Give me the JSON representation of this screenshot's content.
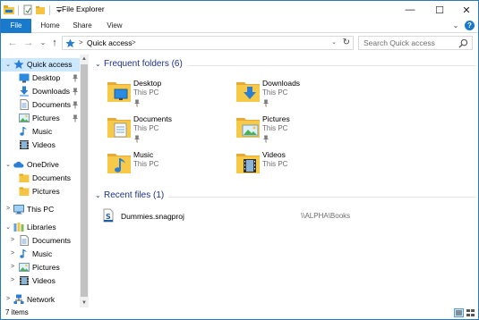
{
  "titlebar": {
    "title": "File Explorer",
    "minimize": "—",
    "maximize": "☐",
    "close": "✕"
  },
  "ribbon": {
    "tabs": [
      "File",
      "Home",
      "Share",
      "View"
    ],
    "expand": "⌄",
    "help": "?"
  },
  "navbar": {
    "back": "←",
    "forward": "→",
    "recent": "⌄",
    "up": "↑",
    "address_sep": ">",
    "location": "Quick access",
    "address_dropdown": "⌄",
    "refresh": "↻"
  },
  "search": {
    "placeholder": "Search Quick access"
  },
  "nav_pane": {
    "items": [
      {
        "label": "Quick access",
        "icon": "star-icon",
        "expand": "⌄",
        "pinned": false,
        "selected": true
      },
      {
        "label": "Desktop",
        "icon": "desktop-icon",
        "expand": "",
        "pinned": true,
        "selected": false
      },
      {
        "label": "Downloads",
        "icon": "downloads-icon",
        "expand": "",
        "pinned": true,
        "selected": false
      },
      {
        "label": "Documents",
        "icon": "documents-icon",
        "expand": "",
        "pinned": true,
        "selected": false
      },
      {
        "label": "Pictures",
        "icon": "pictures-icon",
        "expand": "",
        "pinned": true,
        "selected": false
      },
      {
        "label": "Music",
        "icon": "music-icon",
        "expand": "",
        "pinned": false,
        "selected": false
      },
      {
        "label": "Videos",
        "icon": "videos-icon",
        "expand": "",
        "pinned": false,
        "selected": false
      },
      {
        "label": "OneDrive",
        "icon": "onedrive-icon",
        "expand": "⌄",
        "pinned": false,
        "selected": false
      },
      {
        "label": "Documents",
        "icon": "folder-icon",
        "expand": "",
        "pinned": false,
        "selected": false
      },
      {
        "label": "Pictures",
        "icon": "folder-icon",
        "expand": "",
        "pinned": false,
        "selected": false
      },
      {
        "label": "This PC",
        "icon": "this-pc-icon",
        "expand": ">",
        "pinned": false,
        "selected": false
      },
      {
        "label": "Libraries",
        "icon": "libraries-icon",
        "expand": "⌄",
        "pinned": false,
        "selected": false
      },
      {
        "label": "Documents",
        "icon": "documents-icon",
        "expand": ">",
        "pinned": false,
        "selected": false
      },
      {
        "label": "Music",
        "icon": "music-icon",
        "expand": ">",
        "pinned": false,
        "selected": false
      },
      {
        "label": "Pictures",
        "icon": "pictures-icon",
        "expand": ">",
        "pinned": false,
        "selected": false
      },
      {
        "label": "Videos",
        "icon": "videos-icon",
        "expand": ">",
        "pinned": false,
        "selected": false
      },
      {
        "label": "Network",
        "icon": "network-icon",
        "expand": ">",
        "pinned": false,
        "selected": false
      }
    ]
  },
  "frequent": {
    "chevron": "⌄",
    "title": "Frequent folders (6)",
    "folders": [
      {
        "name": "Desktop",
        "location": "This PC",
        "pinned": true,
        "icon": "desktop-folder-icon"
      },
      {
        "name": "Downloads",
        "location": "This PC",
        "pinned": true,
        "icon": "downloads-folder-icon"
      },
      {
        "name": "Documents",
        "location": "This PC",
        "pinned": true,
        "icon": "documents-folder-icon"
      },
      {
        "name": "Pictures",
        "location": "This PC",
        "pinned": true,
        "icon": "pictures-folder-icon"
      },
      {
        "name": "Music",
        "location": "This PC",
        "pinned": false,
        "icon": "music-folder-icon"
      },
      {
        "name": "Videos",
        "location": "This PC",
        "pinned": false,
        "icon": "videos-folder-icon"
      }
    ]
  },
  "recent": {
    "chevron": "⌄",
    "title": "Recent files (1)",
    "files": [
      {
        "name": "Dummies.snagproj",
        "path": "\\\\ALPHA\\Books",
        "icon": "snagit-file-icon"
      }
    ]
  },
  "status": {
    "items": "7 items"
  },
  "colors": {
    "accent": "#1979ca",
    "selection": "#cce8ff",
    "folder": "#f5c542",
    "group_title": "#1e3287"
  }
}
